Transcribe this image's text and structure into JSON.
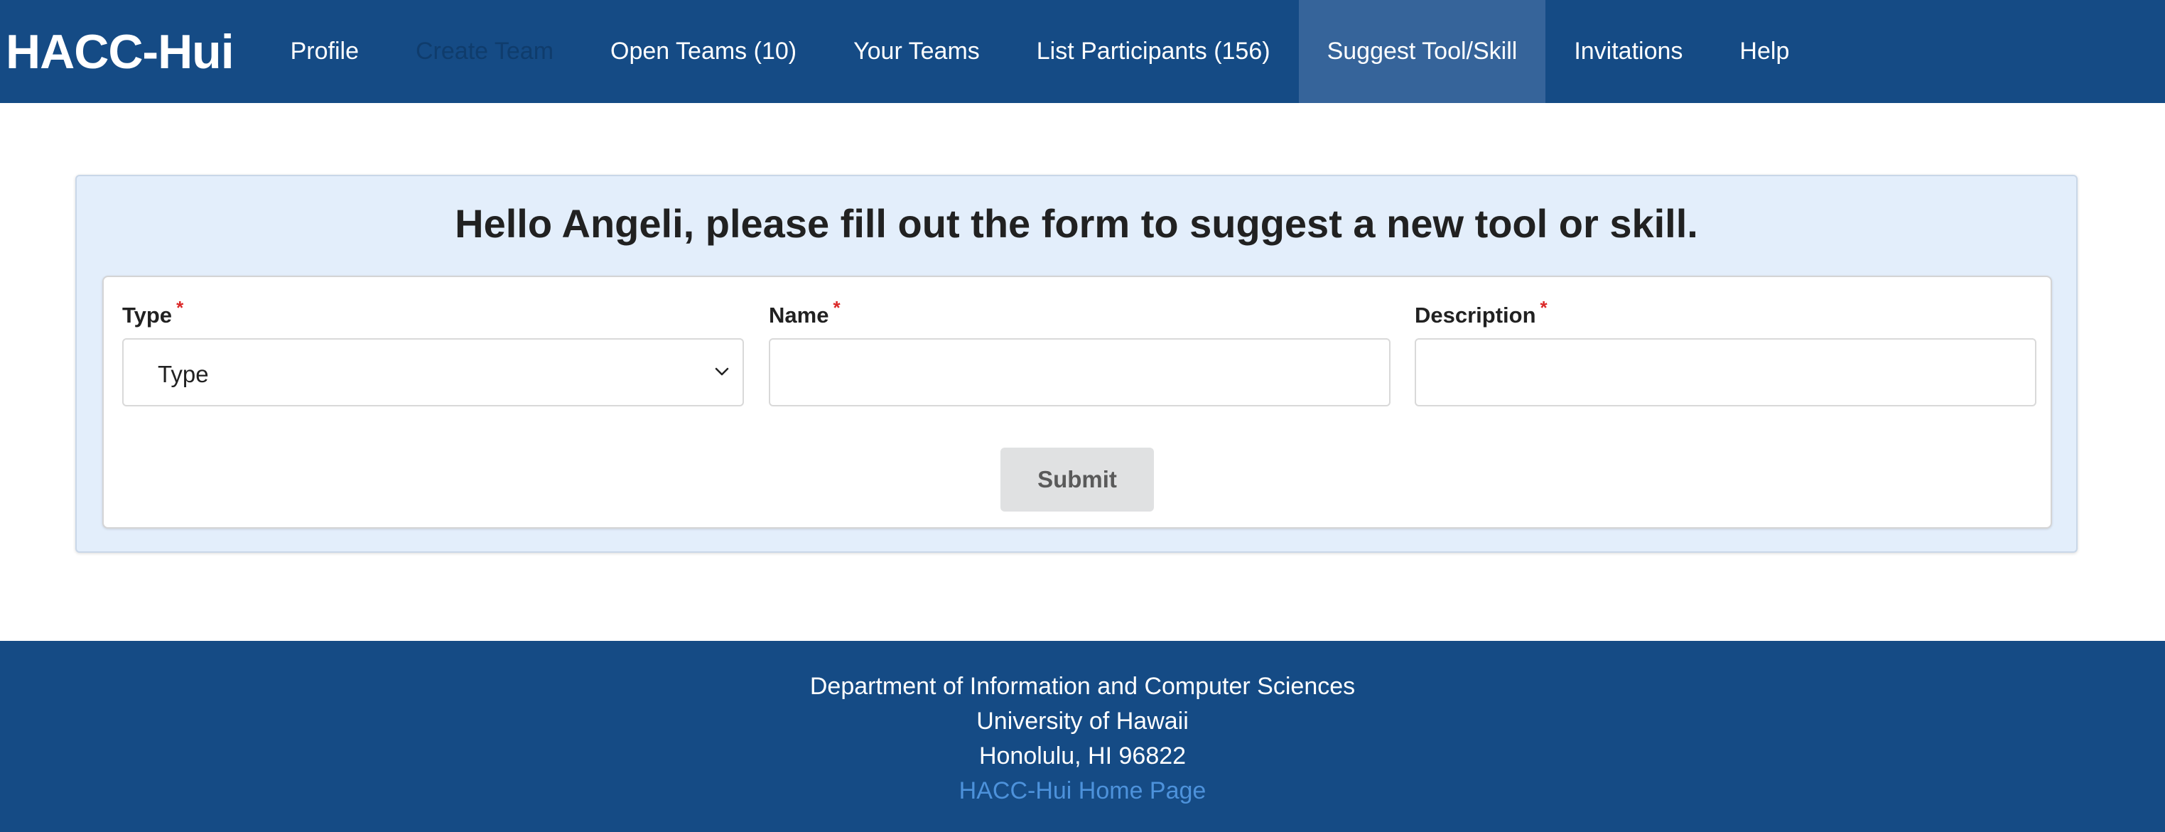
{
  "navbar": {
    "brand": "HACC-Hui",
    "items": [
      {
        "label": "Profile"
      },
      {
        "label": "Create Team"
      },
      {
        "label": "Open Teams (10)"
      },
      {
        "label": "Your Teams"
      },
      {
        "label": "List Participants (156)"
      },
      {
        "label": "Suggest Tool/Skill"
      },
      {
        "label": "Invitations"
      },
      {
        "label": "Help"
      }
    ],
    "active_item": "Suggest Tool/Skill",
    "colors": {
      "background": "#154b85",
      "active_background": "#36649a"
    }
  },
  "form": {
    "title": "Hello Angeli, please fill out the form to suggest a new tool or skill.",
    "required_marker": "*",
    "type_field": {
      "label": "Type",
      "selected": "Type"
    },
    "name_field": {
      "label": "Name",
      "value": ""
    },
    "description_field": {
      "label": "Description",
      "value": ""
    },
    "submit_label": "Submit",
    "icons": {
      "type_dropdown": "chevron-down-icon"
    },
    "colors": {
      "panel_background": "#e3eefb",
      "required": "#db2828"
    }
  },
  "footer": {
    "lines": [
      "Department of Information and Computer Sciences",
      "University of Hawaii",
      "Honolulu, HI 96822"
    ],
    "link": "HACC-Hui Home Page",
    "colors": {
      "background": "#154b85",
      "link": "#4d92db"
    }
  }
}
